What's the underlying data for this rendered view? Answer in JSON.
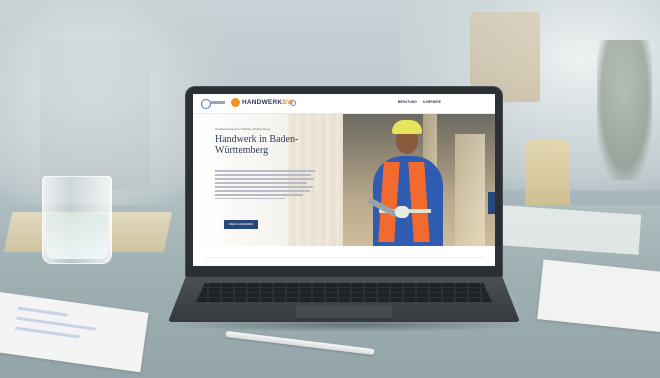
{
  "scene": {
    "objects": [
      "water-glass",
      "laptop",
      "papers",
      "pen",
      "folder",
      "chair"
    ]
  },
  "website": {
    "partner_logo": "",
    "brand_prefix": "HANDWERK",
    "brand_suffix": "BW",
    "nav": [
      "BERATUNG",
      "KARRIERE"
    ],
    "eyebrow": "Handwerkskammern Baden-Württemberg",
    "hero_title_line1": "Handwerk in Baden-",
    "hero_title_line2": "Württemberg",
    "cta_label": "MEHR ERFAHREN"
  },
  "colors": {
    "brand_orange": "#f29221",
    "brand_navy": "#28477a"
  }
}
